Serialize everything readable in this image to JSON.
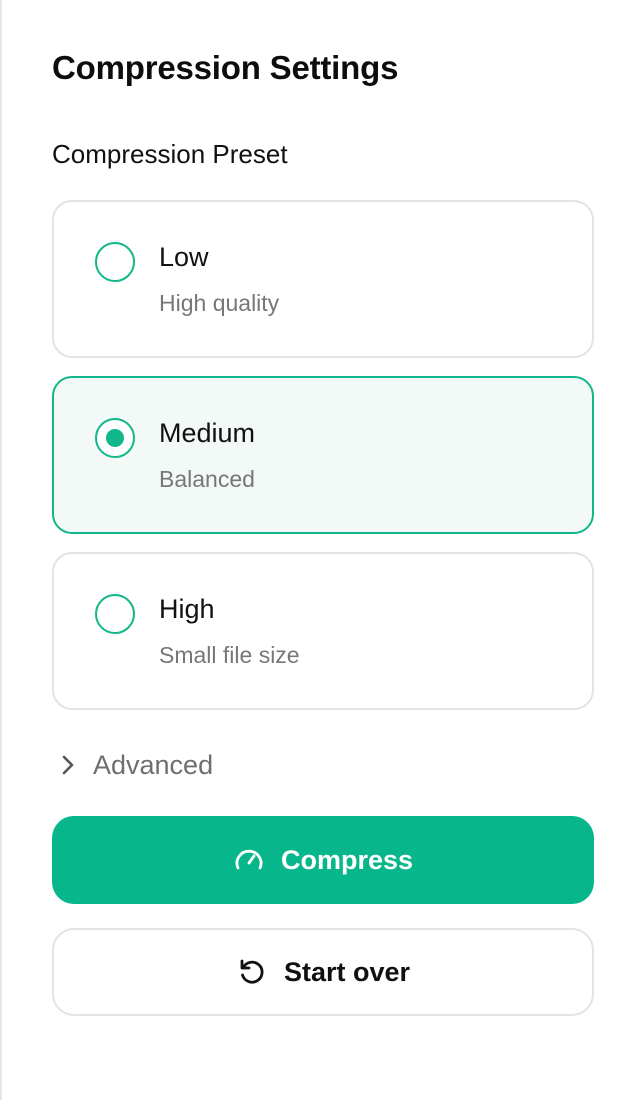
{
  "panel": {
    "title": "Compression Settings",
    "preset_label": "Compression Preset",
    "presets": [
      {
        "title": "Low",
        "subtitle": "High quality",
        "selected": false
      },
      {
        "title": "Medium",
        "subtitle": "Balanced",
        "selected": true
      },
      {
        "title": "High",
        "subtitle": "Small file size",
        "selected": false
      }
    ],
    "advanced_label": "Advanced",
    "compress_label": "Compress",
    "start_over_label": "Start over"
  },
  "icons": {
    "advanced": "chevron-right-icon",
    "compress": "gauge-icon",
    "start_over": "rotate-ccw-icon"
  },
  "colors": {
    "accent": "#07b78b",
    "selected_bg": "#f2f9f6",
    "border": "#e3e3e3",
    "muted_text": "#777777"
  }
}
